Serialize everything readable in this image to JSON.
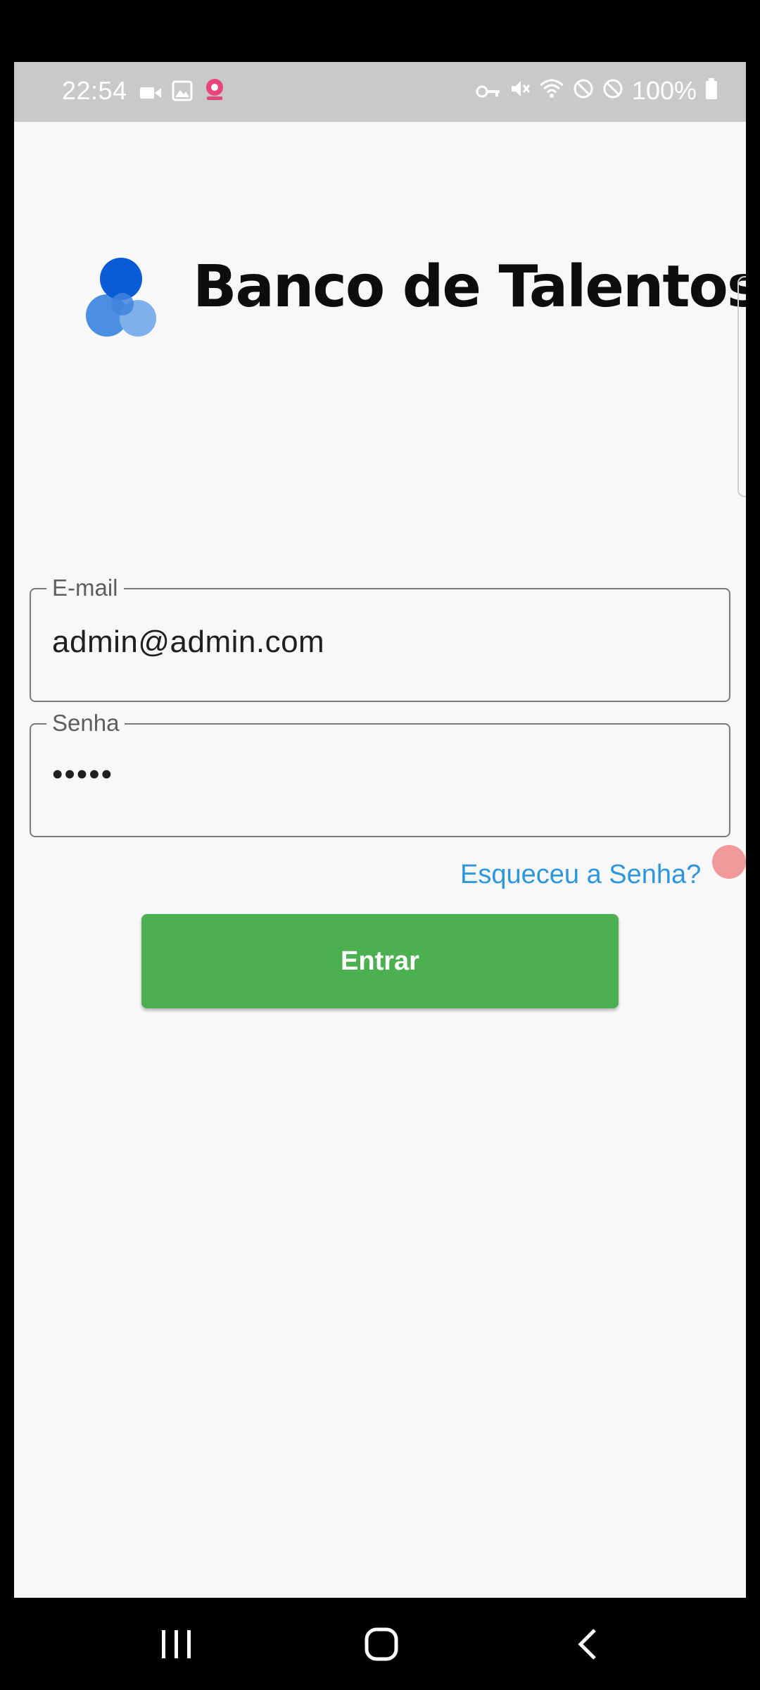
{
  "status_bar": {
    "time": "22:54",
    "battery": "100%",
    "left_icons": [
      "video-camera-icon",
      "gallery-icon",
      "recorder-icon"
    ],
    "right_icons": [
      "vpn-key-icon",
      "mute-icon",
      "wifi-icon",
      "block-icon",
      "block-icon",
      "battery-icon"
    ]
  },
  "brand": {
    "title": "Banco de Talentos",
    "logo_icon": "bubbles-logo-icon",
    "colors": {
      "dark_blue": "#0a5bd6",
      "mid_blue": "#4a8fe0",
      "light_blue": "#7fb0ea"
    }
  },
  "form": {
    "email": {
      "label": "E-mail",
      "value": "admin@admin.com"
    },
    "password": {
      "label": "Senha",
      "value": "•••••"
    },
    "forgot_label": "Esqueceu a Senha?",
    "submit_label": "Entrar"
  },
  "colors": {
    "accent_green": "#4caf50",
    "link_blue": "#2e96dc",
    "background": "#f8f8f8"
  },
  "nav_bar": {
    "icons": [
      "recent-apps-icon",
      "home-icon",
      "back-icon"
    ]
  }
}
